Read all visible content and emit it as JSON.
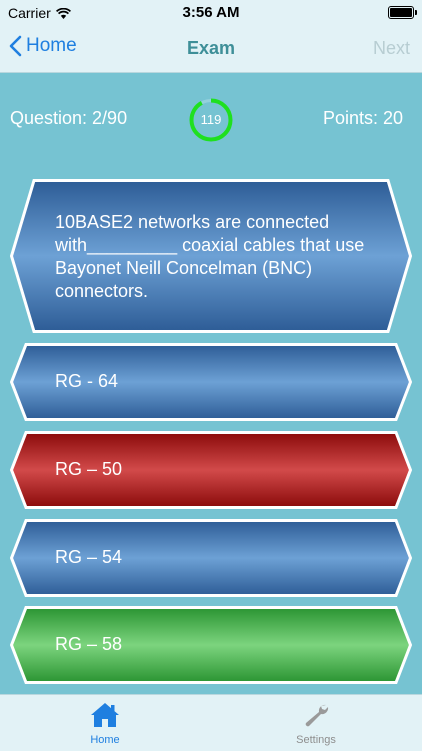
{
  "status_bar": {
    "carrier": "Carrier",
    "time": "3:56 AM"
  },
  "nav": {
    "back_label": "Home",
    "title": "Exam",
    "next_label": "Next"
  },
  "exam": {
    "question_counter": "Question: 2/90",
    "timer_value": "119",
    "timer_progress": 0.92,
    "points": "Points: 20"
  },
  "question": {
    "text": "10BASE2 networks are connected with_________ coaxial cables that use Bayonet Neill Concelman (BNC) connectors."
  },
  "answers": [
    {
      "label": "RG - 64",
      "state": "neutral"
    },
    {
      "label": "RG – 50",
      "state": "wrong"
    },
    {
      "label": "RG – 54",
      "state": "neutral"
    },
    {
      "label": "RG – 58",
      "state": "correct"
    }
  ],
  "colors": {
    "neutral": [
      "#2d5c96",
      "#6da1d5"
    ],
    "wrong": [
      "#8a0a0a",
      "#d24a4a"
    ],
    "correct": [
      "#2a9432",
      "#7cd47e"
    ],
    "timer_ring": "#1fe01f",
    "tint": "#1f7fe0"
  },
  "tabs": [
    {
      "label": "Home",
      "icon": "home-icon",
      "selected": true
    },
    {
      "label": "Settings",
      "icon": "wrench-icon",
      "selected": false
    }
  ]
}
